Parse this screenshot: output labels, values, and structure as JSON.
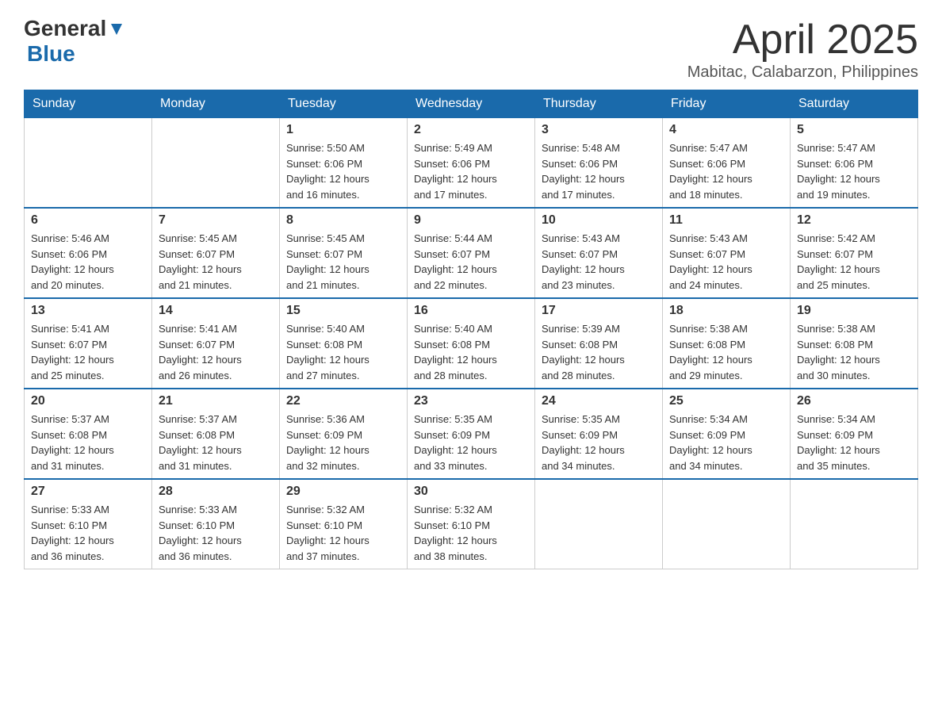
{
  "header": {
    "logo": {
      "general": "General",
      "blue": "Blue"
    },
    "title": "April 2025",
    "subtitle": "Mabitac, Calabarzon, Philippines"
  },
  "weekdays": [
    "Sunday",
    "Monday",
    "Tuesday",
    "Wednesday",
    "Thursday",
    "Friday",
    "Saturday"
  ],
  "weeks": [
    [
      {
        "day": "",
        "info": ""
      },
      {
        "day": "",
        "info": ""
      },
      {
        "day": "1",
        "info": "Sunrise: 5:50 AM\nSunset: 6:06 PM\nDaylight: 12 hours\nand 16 minutes."
      },
      {
        "day": "2",
        "info": "Sunrise: 5:49 AM\nSunset: 6:06 PM\nDaylight: 12 hours\nand 17 minutes."
      },
      {
        "day": "3",
        "info": "Sunrise: 5:48 AM\nSunset: 6:06 PM\nDaylight: 12 hours\nand 17 minutes."
      },
      {
        "day": "4",
        "info": "Sunrise: 5:47 AM\nSunset: 6:06 PM\nDaylight: 12 hours\nand 18 minutes."
      },
      {
        "day": "5",
        "info": "Sunrise: 5:47 AM\nSunset: 6:06 PM\nDaylight: 12 hours\nand 19 minutes."
      }
    ],
    [
      {
        "day": "6",
        "info": "Sunrise: 5:46 AM\nSunset: 6:06 PM\nDaylight: 12 hours\nand 20 minutes."
      },
      {
        "day": "7",
        "info": "Sunrise: 5:45 AM\nSunset: 6:07 PM\nDaylight: 12 hours\nand 21 minutes."
      },
      {
        "day": "8",
        "info": "Sunrise: 5:45 AM\nSunset: 6:07 PM\nDaylight: 12 hours\nand 21 minutes."
      },
      {
        "day": "9",
        "info": "Sunrise: 5:44 AM\nSunset: 6:07 PM\nDaylight: 12 hours\nand 22 minutes."
      },
      {
        "day": "10",
        "info": "Sunrise: 5:43 AM\nSunset: 6:07 PM\nDaylight: 12 hours\nand 23 minutes."
      },
      {
        "day": "11",
        "info": "Sunrise: 5:43 AM\nSunset: 6:07 PM\nDaylight: 12 hours\nand 24 minutes."
      },
      {
        "day": "12",
        "info": "Sunrise: 5:42 AM\nSunset: 6:07 PM\nDaylight: 12 hours\nand 25 minutes."
      }
    ],
    [
      {
        "day": "13",
        "info": "Sunrise: 5:41 AM\nSunset: 6:07 PM\nDaylight: 12 hours\nand 25 minutes."
      },
      {
        "day": "14",
        "info": "Sunrise: 5:41 AM\nSunset: 6:07 PM\nDaylight: 12 hours\nand 26 minutes."
      },
      {
        "day": "15",
        "info": "Sunrise: 5:40 AM\nSunset: 6:08 PM\nDaylight: 12 hours\nand 27 minutes."
      },
      {
        "day": "16",
        "info": "Sunrise: 5:40 AM\nSunset: 6:08 PM\nDaylight: 12 hours\nand 28 minutes."
      },
      {
        "day": "17",
        "info": "Sunrise: 5:39 AM\nSunset: 6:08 PM\nDaylight: 12 hours\nand 28 minutes."
      },
      {
        "day": "18",
        "info": "Sunrise: 5:38 AM\nSunset: 6:08 PM\nDaylight: 12 hours\nand 29 minutes."
      },
      {
        "day": "19",
        "info": "Sunrise: 5:38 AM\nSunset: 6:08 PM\nDaylight: 12 hours\nand 30 minutes."
      }
    ],
    [
      {
        "day": "20",
        "info": "Sunrise: 5:37 AM\nSunset: 6:08 PM\nDaylight: 12 hours\nand 31 minutes."
      },
      {
        "day": "21",
        "info": "Sunrise: 5:37 AM\nSunset: 6:08 PM\nDaylight: 12 hours\nand 31 minutes."
      },
      {
        "day": "22",
        "info": "Sunrise: 5:36 AM\nSunset: 6:09 PM\nDaylight: 12 hours\nand 32 minutes."
      },
      {
        "day": "23",
        "info": "Sunrise: 5:35 AM\nSunset: 6:09 PM\nDaylight: 12 hours\nand 33 minutes."
      },
      {
        "day": "24",
        "info": "Sunrise: 5:35 AM\nSunset: 6:09 PM\nDaylight: 12 hours\nand 34 minutes."
      },
      {
        "day": "25",
        "info": "Sunrise: 5:34 AM\nSunset: 6:09 PM\nDaylight: 12 hours\nand 34 minutes."
      },
      {
        "day": "26",
        "info": "Sunrise: 5:34 AM\nSunset: 6:09 PM\nDaylight: 12 hours\nand 35 minutes."
      }
    ],
    [
      {
        "day": "27",
        "info": "Sunrise: 5:33 AM\nSunset: 6:10 PM\nDaylight: 12 hours\nand 36 minutes."
      },
      {
        "day": "28",
        "info": "Sunrise: 5:33 AM\nSunset: 6:10 PM\nDaylight: 12 hours\nand 36 minutes."
      },
      {
        "day": "29",
        "info": "Sunrise: 5:32 AM\nSunset: 6:10 PM\nDaylight: 12 hours\nand 37 minutes."
      },
      {
        "day": "30",
        "info": "Sunrise: 5:32 AM\nSunset: 6:10 PM\nDaylight: 12 hours\nand 38 minutes."
      },
      {
        "day": "",
        "info": ""
      },
      {
        "day": "",
        "info": ""
      },
      {
        "day": "",
        "info": ""
      }
    ]
  ]
}
